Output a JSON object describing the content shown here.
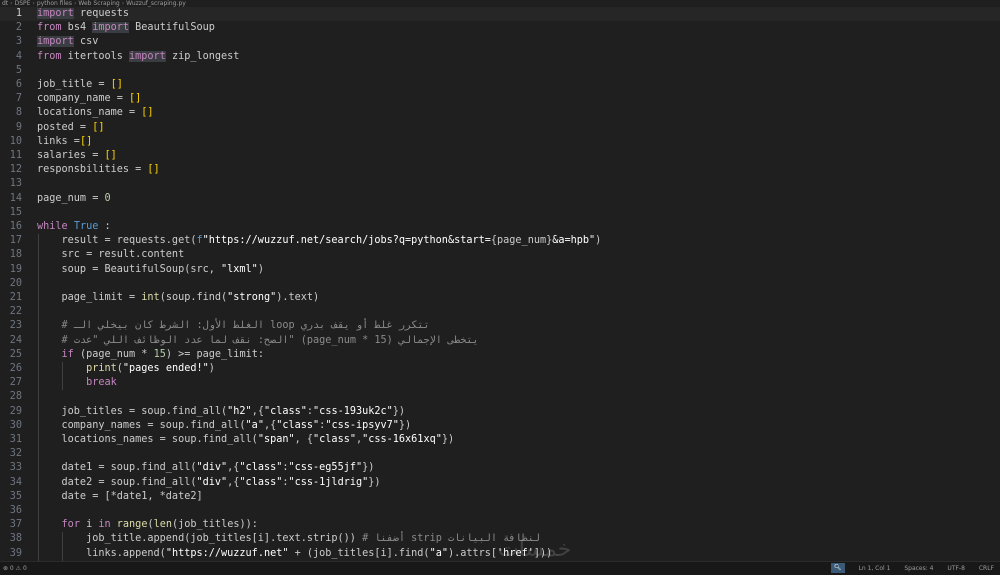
{
  "breadcrumb": [
    "dt",
    "DSPE",
    "python files",
    "Web Scraping",
    "Wuzzuf_scraping.py"
  ],
  "current_line": 1,
  "lines": [
    {
      "n": "1",
      "html": "<span class='k hl'>import</span> requests"
    },
    {
      "n": "2",
      "html": "<span class='k'>from</span> bs4 <span class='k hl'>import</span> BeautifulSoup"
    },
    {
      "n": "3",
      "html": "<span class='k hl'>import</span> csv"
    },
    {
      "n": "4",
      "html": "<span class='k'>from</span> itertools <span class='k hl'>import</span> zip_longest"
    },
    {
      "n": "5",
      "html": ""
    },
    {
      "n": "6",
      "html": "job_title = <span class='b'>[]</span>"
    },
    {
      "n": "7",
      "html": "company_name = <span class='b'>[]</span>"
    },
    {
      "n": "8",
      "html": "locations_name = <span class='b'>[]</span>"
    },
    {
      "n": "9",
      "html": "posted = <span class='b'>[]</span>"
    },
    {
      "n": "10",
      "html": "links =<span class='b'>[]</span>"
    },
    {
      "n": "11",
      "html": "salaries = <span class='b'>[]</span>"
    },
    {
      "n": "12",
      "html": "responsbilities = <span class='b'>[]</span>"
    },
    {
      "n": "13",
      "html": ""
    },
    {
      "n": "14",
      "html": "page_num = <span class='n'>0</span>"
    },
    {
      "n": "15",
      "html": ""
    },
    {
      "n": "16",
      "html": "<span class='k'>while</span> <span class='kb'>True</span> :"
    },
    {
      "n": "17",
      "html": "    result = requests.get(<span class='kb'>f</span><span class='s'>\"https://wuzzuf.net/search/jobs?q=python&amp;start=</span>{page_num}<span class='s'>&amp;a=hpb\"</span>)"
    },
    {
      "n": "18",
      "html": "    src = result.content"
    },
    {
      "n": "19",
      "html": "    soup = BeautifulSoup(src, <span class='s'>\"lxml\"</span>)"
    },
    {
      "n": "20",
      "html": ""
    },
    {
      "n": "21",
      "html": "    page_limit = <span class='f'>int</span>(soup.find(<span class='s'>\"strong\"</span>).text)"
    },
    {
      "n": "22",
      "html": ""
    },
    {
      "n": "23",
      "html": "    <span class='c'># ‏الغلط الأول: الشرط كان بيخلي الـ loop تتكرر غلط أو يقف بدري</span>"
    },
    {
      "n": "24",
      "html": "    <span class='c'># ‏الصح: نقف لما عدد الوظائف اللي \"عدت\" (page_num * 15) يتخطى الإجمالي</span>"
    },
    {
      "n": "25",
      "html": "    <span class='k'>if</span> (page_num * <span class='n'>15</span>) &gt;= page_limit:"
    },
    {
      "n": "26",
      "html": "        <span class='f'>print</span>(<span class='s'>\"pages ended!\"</span>)"
    },
    {
      "n": "27",
      "html": "        <span class='k'>break</span>"
    },
    {
      "n": "28",
      "html": ""
    },
    {
      "n": "29",
      "html": "    job_titles = soup.find_all(<span class='s'>\"h2\"</span>,{<span class='s'>\"class\"</span>:<span class='s'>\"css-193uk2c\"</span>})"
    },
    {
      "n": "30",
      "html": "    company_names = soup.find_all(<span class='s'>\"a\"</span>,{<span class='s'>\"class\"</span>:<span class='s'>\"css-ipsyv7\"</span>})"
    },
    {
      "n": "31",
      "html": "    locations_names = soup.find_all(<span class='s'>\"span\"</span>, {<span class='s'>\"class\"</span>,<span class='s'>\"css-16x61xq\"</span>})"
    },
    {
      "n": "32",
      "html": ""
    },
    {
      "n": "33",
      "html": "    date1 = soup.find_all(<span class='s'>\"div\"</span>,{<span class='s'>\"class\"</span>:<span class='s'>\"css-eg55jf\"</span>})"
    },
    {
      "n": "34",
      "html": "    date2 = soup.find_all(<span class='s'>\"div\"</span>,{<span class='s'>\"class\"</span>:<span class='s'>\"css-1jldrig\"</span>})"
    },
    {
      "n": "35",
      "html": "    date = [*date1, *date2]"
    },
    {
      "n": "36",
      "html": ""
    },
    {
      "n": "37",
      "html": "    <span class='k'>for</span> i <span class='k'>in</span> <span class='f'>range</span>(<span class='f'>len</span>(job_titles)):"
    },
    {
      "n": "38",
      "html": "        job_title.append(job_titles[i].text.strip()) <span class='c'># أضفنا strip لنظافة البيانات</span>"
    },
    {
      "n": "39",
      "html": "        links.append(<span class='s'>\"https://wuzzuf.net\"</span> + (job_titles[i].find(<span class='s'>\"a\"</span>).attrs[<span class='s'>'href'</span>]))"
    }
  ],
  "watermark": "خمسات",
  "statusbar": {
    "left": "⊗ 0 ⚠ 0",
    "zoom_icon": "zoom-icon",
    "position": "Ln 1, Col 1",
    "spaces": "Spaces: 4",
    "encoding": "UTF-8",
    "eol": "CRLF"
  }
}
